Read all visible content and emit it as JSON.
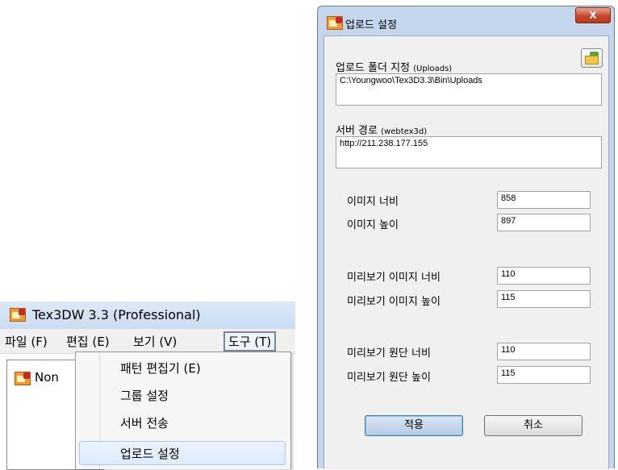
{
  "main_window": {
    "title": "Tex3DW 3.3 (Professional)",
    "menu": [
      {
        "label": "파일 (F)"
      },
      {
        "label": "편집 (E)"
      },
      {
        "label": "보기 (V)"
      },
      {
        "label": "도구 (T)"
      }
    ],
    "document_tab_label": "Non",
    "tools_menu_items": [
      {
        "label": "패턴 편집기 (E)"
      },
      {
        "label": "그룹 설정"
      },
      {
        "label": "서버 전송"
      },
      {
        "label": "업로드 설정"
      }
    ]
  },
  "upload_dialog": {
    "title": "업로드 설정",
    "close_label": "X",
    "upload_folder": {
      "label": "업로드 폴더 지정",
      "sub": "(Uploads)",
      "value": "C:\\Youngwoo\\Tex3D3.3\\Bin\\Uploads"
    },
    "server_path": {
      "label": "서버 경로",
      "sub": "(webtex3d)",
      "value": "http://211.238.177.155"
    },
    "fields": [
      {
        "label": "이미지 너비",
        "value": "858"
      },
      {
        "label": "이미지 높이",
        "value": "897"
      },
      {
        "label": "미리보기 이미지 너비",
        "value": "110"
      },
      {
        "label": "미리보기 이미지 높이",
        "value": "115"
      },
      {
        "label": "미리보기 원단 너비",
        "value": "110"
      },
      {
        "label": "미리보기 원단 높이",
        "value": "115"
      }
    ],
    "apply_label": "적용",
    "cancel_label": "취소"
  }
}
